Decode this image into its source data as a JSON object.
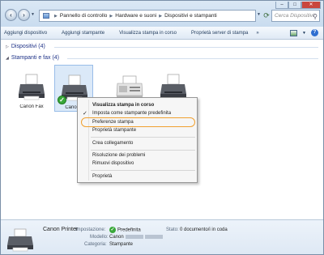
{
  "address_bar": {
    "crumbs": [
      "Pannello di controllo",
      "Hardware e suoni",
      "Dispositivi e stampanti"
    ],
    "search_placeholder": "Cerca Dispositivi"
  },
  "toolbar": {
    "items": [
      "Aggiungi dispositivo",
      "Aggiungi stampante",
      "Visualizza stampa in corso",
      "Proprietà server di stampa"
    ],
    "more": "»"
  },
  "groups": {
    "devices_header": "Dispositivi (4)",
    "printers_header": "Stampanti e fax (4)"
  },
  "printers": [
    {
      "label": "Canon Fax",
      "icon": "fax-printer-icon"
    },
    {
      "label": "Canon P",
      "icon": "printer-icon",
      "selected": true,
      "default": true
    },
    {
      "label": "",
      "icon": "fax-machine-icon"
    },
    {
      "label": "",
      "icon": "printer-icon"
    }
  ],
  "context_menu": {
    "items": [
      {
        "label": "Visualizza stampa in corso",
        "bold": true
      },
      {
        "label": "Imposta come stampante predefinita",
        "checked": true
      },
      {
        "label": "Preferenze stampa",
        "highlighted": true
      },
      {
        "label": "Proprietà stampante"
      },
      {
        "label": "Crea collegamento"
      },
      {
        "label": "Risoluzione dei problemi"
      },
      {
        "label": "Rimuovi dispositivo"
      },
      {
        "label": "Proprietà"
      }
    ]
  },
  "details": {
    "name": "Canon Printer",
    "status_label": "Impostazione:",
    "status_value": "Predefinita",
    "model_label": "Modello:",
    "model_value": "Canon",
    "category_label": "Categoria:",
    "category_value": "Stampante",
    "state_label": "Stato:",
    "state_value": "0 documento/i in coda"
  },
  "colors": {
    "highlight_outline": "#f0a030",
    "group_header": "#1e3287",
    "selection": "#dbe9f8"
  }
}
